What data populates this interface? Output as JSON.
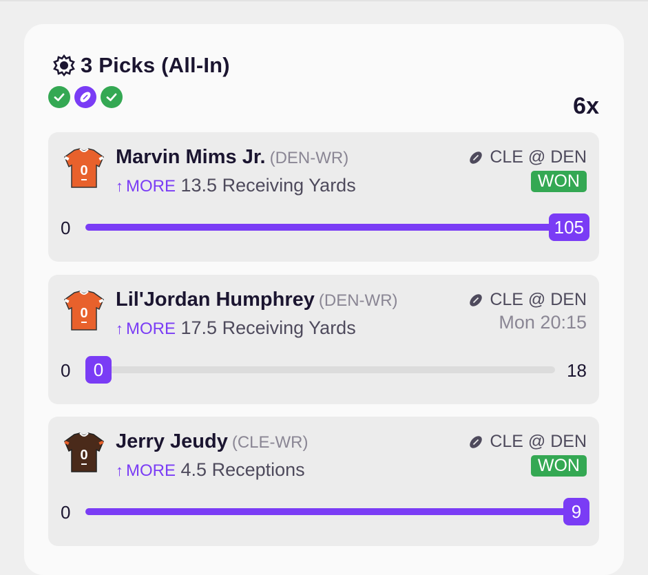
{
  "header": {
    "title": "3 Picks (All-In)",
    "multiplier": "6x",
    "status_icons": [
      "check-icon",
      "football-icon",
      "check-icon"
    ]
  },
  "picks": [
    {
      "player": "Marvin Mims Jr.",
      "position": "(DEN-WR)",
      "direction": "MORE",
      "line_value": "13.5",
      "stat": "Receiving Yards",
      "matchup": "CLE @ DEN",
      "status": "WON",
      "start_label": "0",
      "current": "105",
      "progress_percent": 100,
      "target_label": "",
      "jersey_color": "#e8612c"
    },
    {
      "player": "Lil'Jordan Humphrey",
      "position": "(DEN-WR)",
      "direction": "MORE",
      "line_value": "17.5",
      "stat": "Receiving Yards",
      "matchup": "CLE @ DEN",
      "status": "Mon 20:15",
      "start_label": "0",
      "current": "0",
      "progress_percent": 0,
      "target_label": "18",
      "jersey_color": "#e8612c"
    },
    {
      "player": "Jerry Jeudy",
      "position": "(CLE-WR)",
      "direction": "MORE",
      "line_value": "4.5",
      "stat": "Receptions",
      "matchup": "CLE @ DEN",
      "status": "WON",
      "start_label": "0",
      "current": "9",
      "progress_percent": 100,
      "target_label": "",
      "jersey_color": "#4a2a1a"
    }
  ],
  "colors": {
    "accent": "#7a3cf5",
    "won": "#34a853"
  }
}
